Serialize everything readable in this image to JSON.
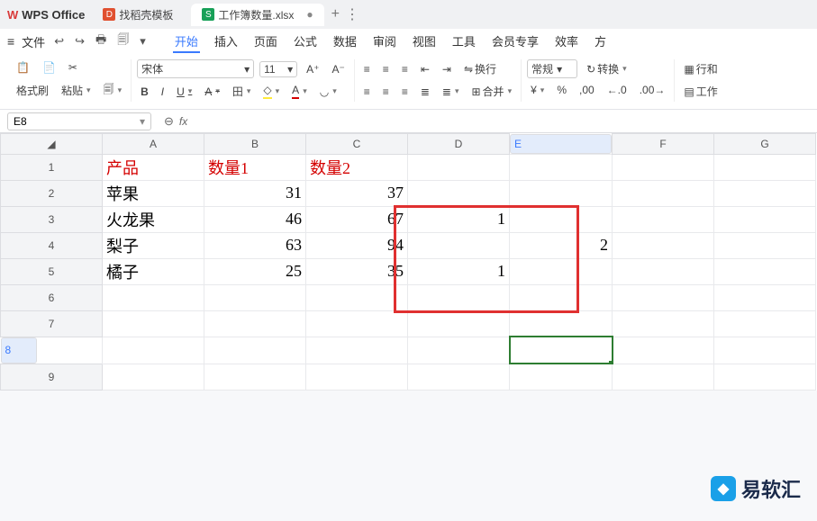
{
  "titlebar": {
    "app_name": "WPS Office",
    "tabs": [
      {
        "icon_bg": "#e05030",
        "icon_text": "D",
        "label": "找稻壳模板"
      },
      {
        "icon_bg": "#18a058",
        "icon_text": "S",
        "label": "工作簿数量.xlsx",
        "active": true,
        "dirty": "●"
      }
    ],
    "add": "+",
    "more": "⋮"
  },
  "menubar": {
    "file": "文件",
    "tool_icons": [
      "↩",
      "↪",
      "🖶",
      "🗐",
      "▾"
    ],
    "tabs": [
      "开始",
      "插入",
      "页面",
      "公式",
      "数据",
      "审阅",
      "视图",
      "工具",
      "会员专享",
      "效率",
      "方"
    ]
  },
  "ribbon": {
    "clip": {
      "brush": "格式刷",
      "paste": "粘贴",
      "cut": "✂"
    },
    "font": {
      "name": "宋体",
      "size": "11",
      "bold": "B",
      "italic": "I",
      "underline": "U",
      "strike": "A",
      "border": "田",
      "fill": "◇",
      "color": "A",
      "clear": "◡"
    },
    "align": {
      "top": "≡",
      "mid": "≡",
      "bot": "≡",
      "wrap": "换行",
      "left": "≡",
      "center": "≡",
      "right": "≡",
      "jl": "≣",
      "jr": "≣",
      "merge": "合并"
    },
    "number": {
      "fmt": "常规",
      "transpose": "转换",
      "y": "¥",
      "pct": "%",
      "comma": ",",
      "dec_inc": ".0",
      "dec_dec": ".00"
    },
    "cells": {
      "rowcol": "行和",
      "ws": "工作"
    }
  },
  "formula_bar": {
    "namebox": "E8",
    "fx": "fx"
  },
  "columns": [
    "A",
    "B",
    "C",
    "D",
    "E",
    "F",
    "G"
  ],
  "rows": [
    "1",
    "2",
    "3",
    "4",
    "5",
    "6",
    "7",
    "8",
    "9"
  ],
  "cells": {
    "A1": "产品",
    "B1": "数量1",
    "C1": "数量2",
    "A2": "苹果",
    "B2": "31",
    "C2": "37",
    "A3": "火龙果",
    "B3": "46",
    "C3": "67",
    "D3": "1",
    "A4": "梨子",
    "B4": "63",
    "C4": "94",
    "E4": "2",
    "A5": "橘子",
    "B5": "25",
    "C5": "35",
    "D5": "1"
  },
  "watermark": "易软汇"
}
